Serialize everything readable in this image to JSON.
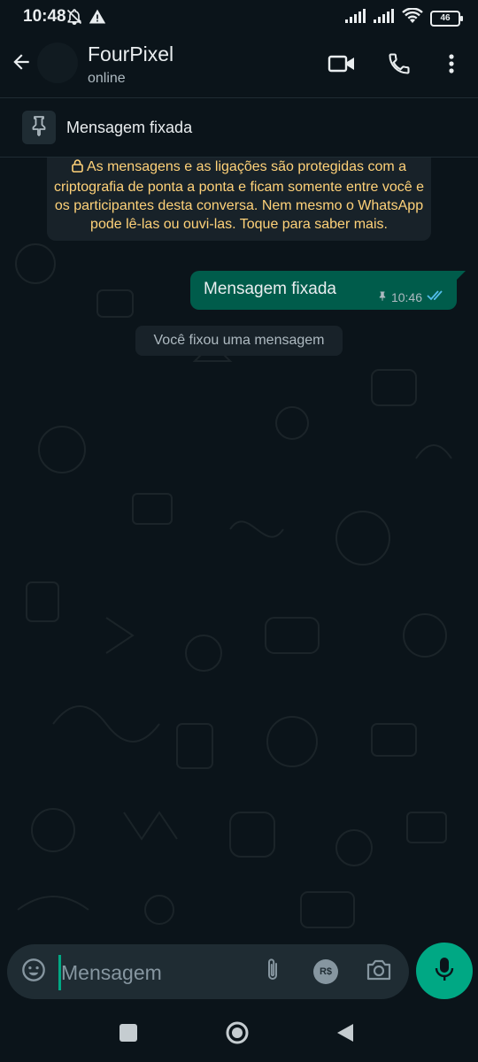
{
  "status_bar": {
    "time": "10:48",
    "battery": "46",
    "icons": [
      "muted-notification-icon",
      "alert-icon",
      "signal-icon",
      "signal-icon",
      "wifi-icon",
      "battery-icon"
    ]
  },
  "header": {
    "contact_name": "FourPixel",
    "contact_status": "online",
    "icons": [
      "back-arrow-icon",
      "video-call-icon",
      "voice-call-icon",
      "more-vert-icon"
    ]
  },
  "pinned": {
    "label": "Mensagem fixada",
    "icon": "pin-icon"
  },
  "chat": {
    "encryption_notice": "As mensagens e as ligações são protegidas com a criptografia de ponta a ponta e ficam somente entre você e os participantes desta conversa. Nem mesmo o WhatsApp pode lê-las ou ouvi-las. Toque para saber mais.",
    "messages": [
      {
        "direction": "outgoing",
        "text": "Mensagem fixada",
        "time": "10:46",
        "pinned": true,
        "read": true
      }
    ],
    "system_message": "Você fixou uma mensagem"
  },
  "composer": {
    "placeholder": "Mensagem",
    "value": "",
    "icons": [
      "emoji-icon",
      "attach-icon",
      "payment-icon",
      "camera-icon",
      "mic-icon"
    ],
    "payment_label": "R$"
  },
  "colors": {
    "background": "#0b141a",
    "outgoing_bubble": "#005c4b",
    "accent": "#00a884",
    "system_bubble": "#182229",
    "encryption_text": "#ffd279",
    "read_ticks": "#53bdeb"
  },
  "navbar": {
    "icons": [
      "recents-icon",
      "home-icon",
      "back-icon"
    ]
  }
}
